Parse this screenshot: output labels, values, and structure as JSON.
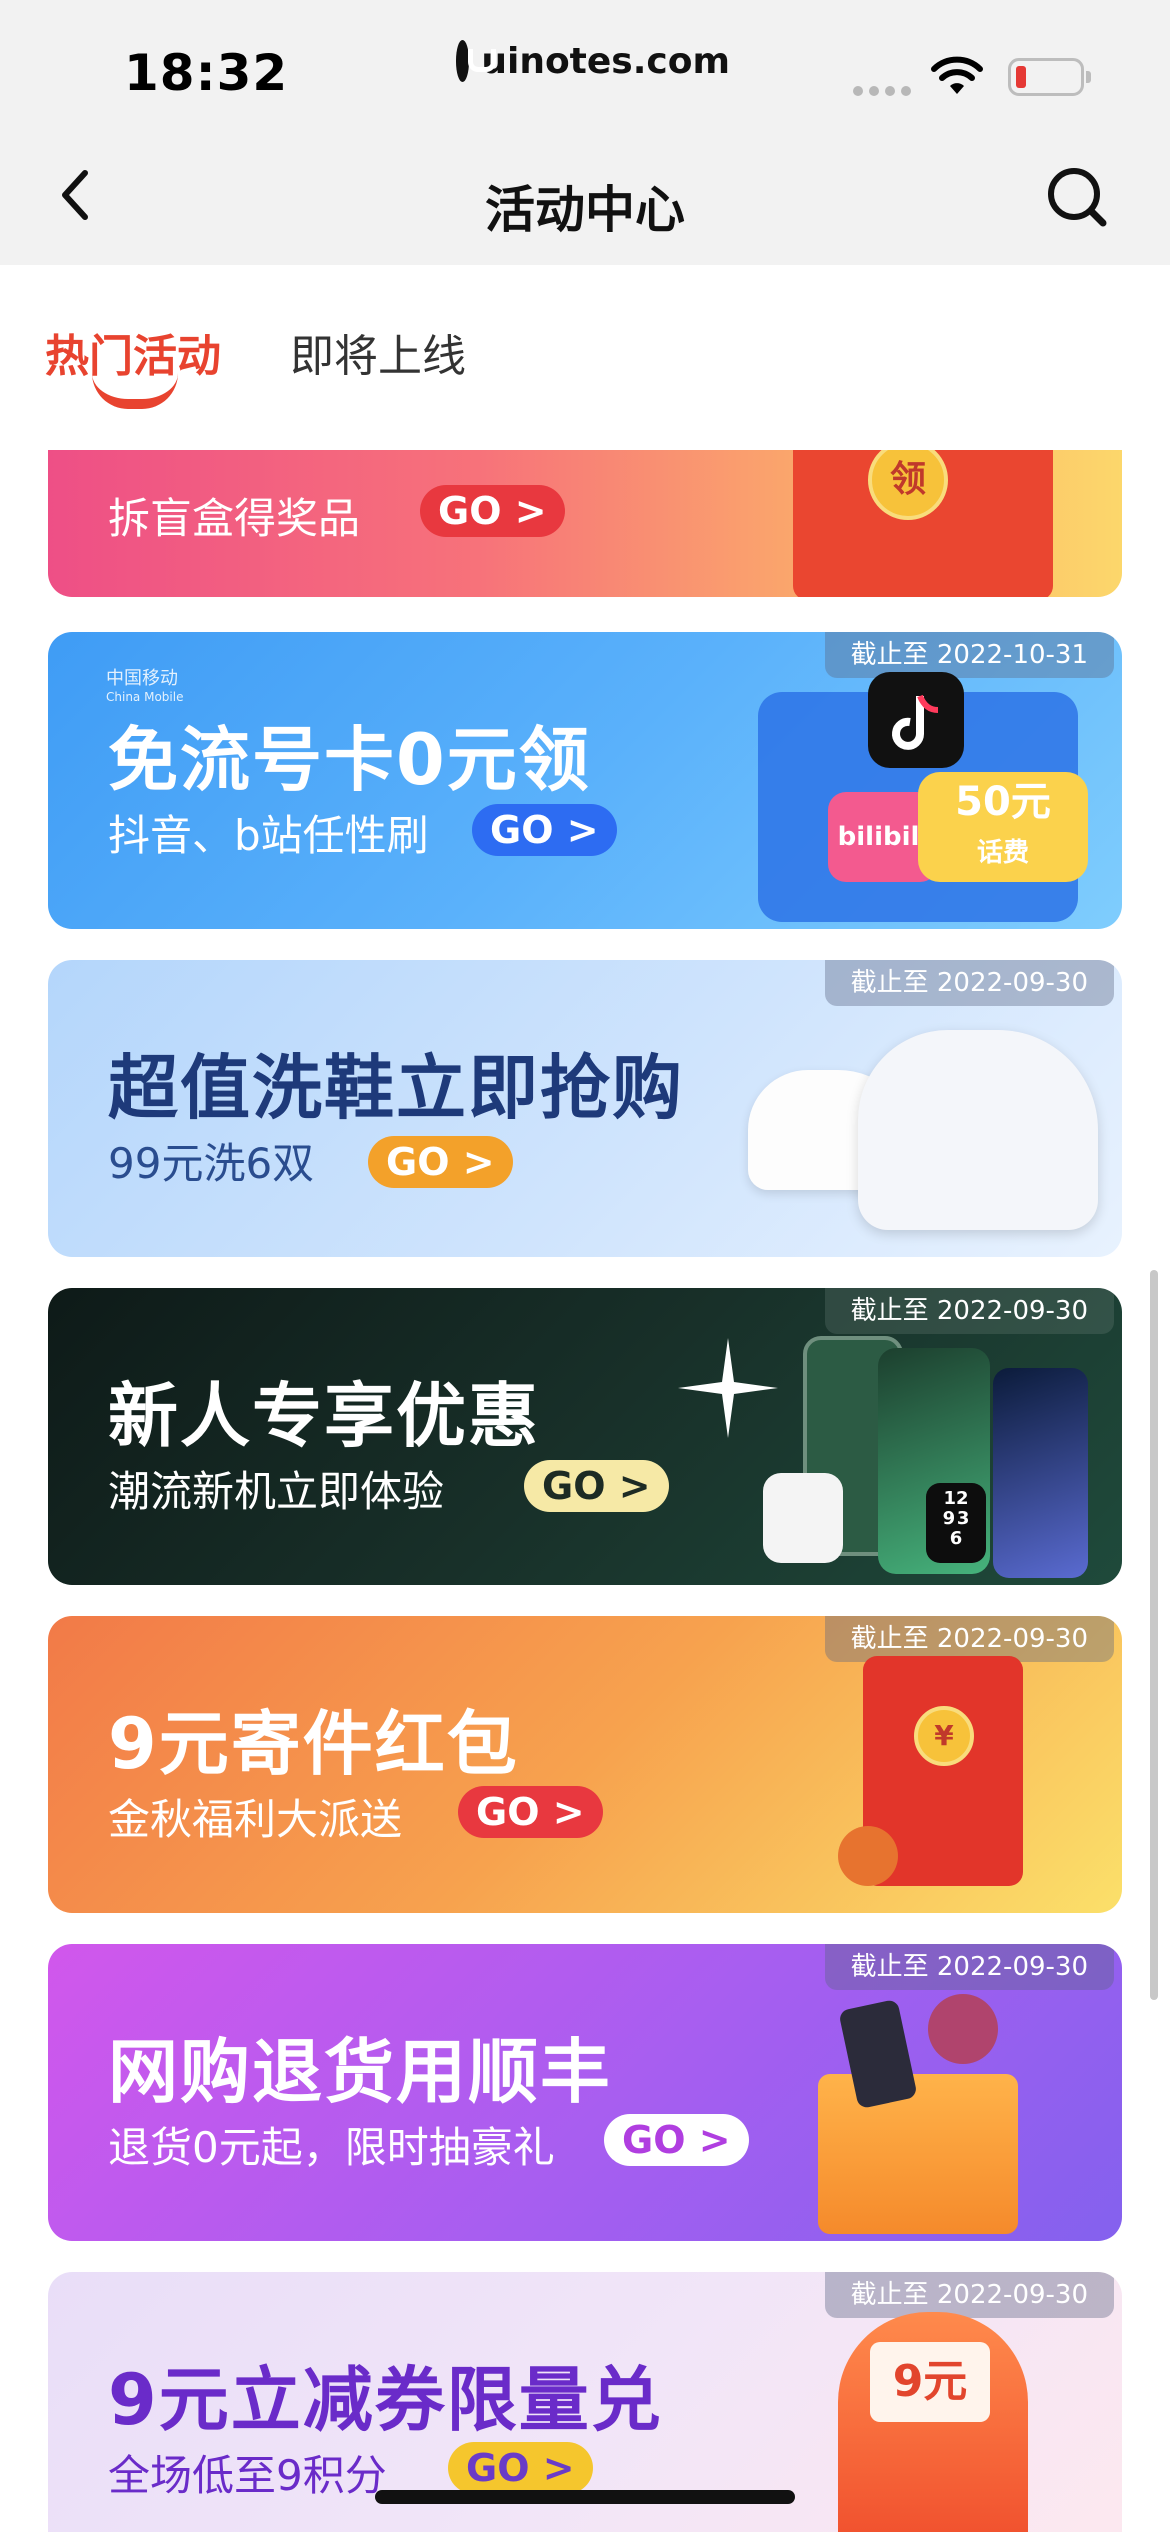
{
  "status_bar": {
    "time": "18:32",
    "url": "uinotes.com"
  },
  "nav": {
    "title": "活动中心"
  },
  "tabs": [
    {
      "label": "热门活动",
      "active": true
    },
    {
      "label": "即将上线",
      "active": false
    }
  ],
  "banners": [
    {
      "title": "",
      "subtitle": "拆盲盒得奖品",
      "go": "GO >",
      "deadline": "",
      "art_text": "领"
    },
    {
      "title": "免流号卡0元领",
      "subtitle": "抖音、b站任性刷",
      "go": "GO >",
      "deadline": "截止至 2022-10-31",
      "logo": "中国移动",
      "logo_sub": "China Mobile",
      "art_text": "50元",
      "art_sub": "话费",
      "art_text2": "bilibili"
    },
    {
      "title": "超值洗鞋立即抢购",
      "subtitle": "99元洗6双",
      "go": "GO >",
      "deadline": "截止至 2022-09-30"
    },
    {
      "title": "新人专享优惠",
      "subtitle": "潮流新机立即体验",
      "go": "GO >",
      "deadline": "截止至 2022-09-30",
      "art_text": "12",
      "art_sub": "9",
      "art_text3": "3",
      "art_text4": "6"
    },
    {
      "title": "9元寄件红包",
      "subtitle": "金秋福利大派送",
      "go": "GO >",
      "deadline": "截止至 2022-09-30",
      "art_text": "¥"
    },
    {
      "title": "网购退货用顺丰",
      "subtitle": "退货0元起，限时抽豪礼",
      "go": "GO >",
      "deadline": "截止至 2022-09-30"
    },
    {
      "title": "9元立减券限量兑",
      "subtitle": "全场低至9积分",
      "go": "GO >",
      "deadline": "截止至 2022-09-30",
      "art_text": "9元"
    }
  ]
}
